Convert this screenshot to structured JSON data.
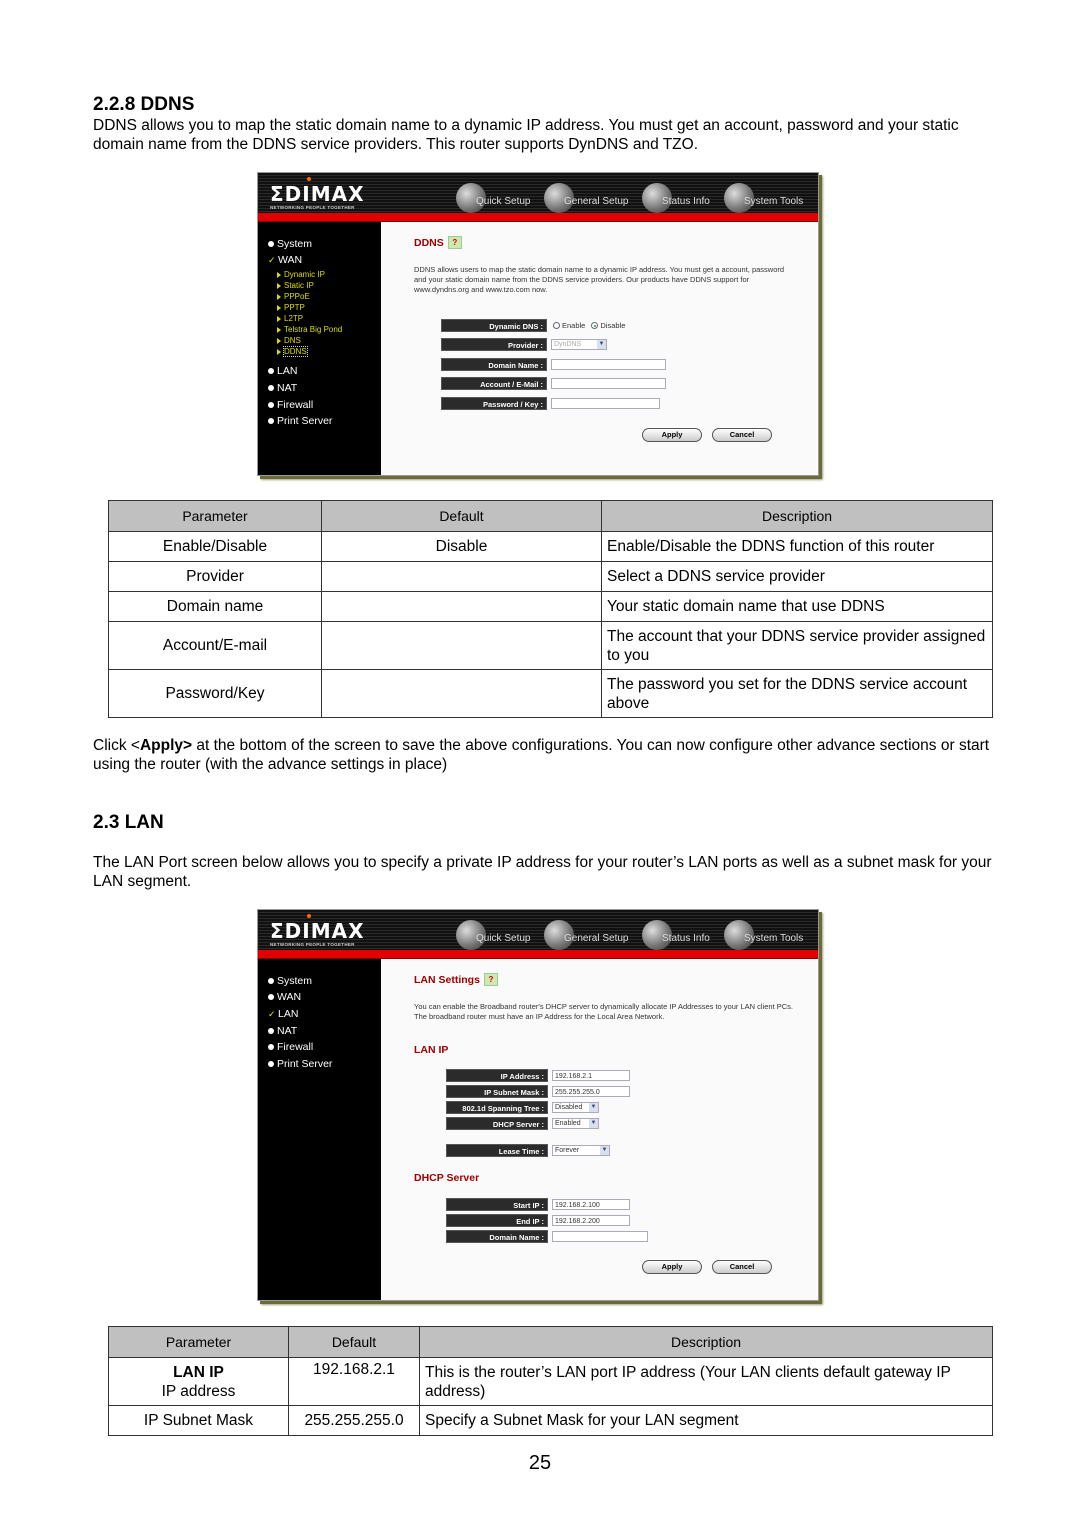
{
  "ddns_section": {
    "heading": "2.2.8 DDNS",
    "intro": "DDNS allows you to map the static domain name to a dynamic IP address. You must get an account, password and your static domain name from the DDNS service providers. This router supports DynDNS and TZO."
  },
  "router_ui": {
    "logo": "ΣDIMAX",
    "tagline": "NETWORKING PEOPLE TOGETHER",
    "nav": [
      "Quick Setup",
      "General Setup",
      "Status Info",
      "System Tools"
    ]
  },
  "ddns_screen": {
    "sidebar": {
      "top_items": [
        "System",
        "WAN"
      ],
      "wan_sub_items": [
        "Dynamic IP",
        "Static IP",
        "PPPoE",
        "PPTP",
        "L2TP",
        "Telstra Big Pond",
        "DNS",
        "DDNS"
      ],
      "bottom_items": [
        "LAN",
        "NAT",
        "Firewall",
        "Print Server"
      ]
    },
    "title": "DDNS",
    "description": "DDNS allows users to map the static domain name to a dynamic IP address. You must get a account, password and your static domain name from the DDNS service providers. Our products have DDNS support for www.dyndns.org and www.tzo.com now.",
    "fields": {
      "dynamic_dns_label": "Dynamic DNS :",
      "enable_label": "Enable",
      "disable_label": "Disable",
      "selected": "Disable",
      "provider_label": "Provider :",
      "provider_value": "DynDNS",
      "domain_name_label": "Domain Name :",
      "domain_name_value": "",
      "account_label": "Account / E-Mail :",
      "account_value": "",
      "password_label": "Password / Key :",
      "password_value": ""
    },
    "apply_label": "Apply",
    "cancel_label": "Cancel"
  },
  "ddns_table": {
    "headers": [
      "Parameter",
      "Default",
      "Description"
    ],
    "rows": [
      {
        "parameter": "Enable/Disable",
        "default": "Disable",
        "description": "Enable/Disable the DDNS function of this router"
      },
      {
        "parameter": "Provider",
        "default": "",
        "description": "Select a DDNS service provider"
      },
      {
        "parameter": "Domain name",
        "default": "",
        "description": "Your static domain name that use DDNS"
      },
      {
        "parameter": "Account/E-mail",
        "default": "",
        "description": "The account that your DDNS service provider assigned to you"
      },
      {
        "parameter": "Password/Key",
        "default": "",
        "description": "The password you set for the DDNS service account above"
      }
    ]
  },
  "apply_note": {
    "prefix": "Click <",
    "bold": "Apply>",
    "suffix": " at the bottom of the screen to save the above configurations. You can now configure other advance sections or start using the router (with the advance settings in place)"
  },
  "lan_section": {
    "heading": "2.3 LAN",
    "intro": "The LAN Port screen below allows you to specify a private IP address for your router’s LAN ports as well as a subnet mask for your LAN segment."
  },
  "lan_screen": {
    "sidebar": {
      "items": [
        "System",
        "WAN",
        "LAN",
        "NAT",
        "Firewall",
        "Print Server"
      ],
      "active": "LAN"
    },
    "title": "LAN Settings",
    "description": "You can enable the Broadband router's DHCP server to dynamically allocate IP Addresses to your LAN client PCs. The broadband router must have an IP Address for the Local Area Network.",
    "lan_ip_heading": "LAN IP",
    "fields": {
      "ip_address_label": "IP Address :",
      "ip_address_value": "192.168.2.1",
      "subnet_label": "IP Subnet Mask :",
      "subnet_value": "255.255.255.0",
      "spanning_label": "802.1d Spanning Tree :",
      "spanning_value": "Disabled",
      "dhcp_label": "DHCP Server :",
      "dhcp_value": "Enabled",
      "lease_label": "Lease Time :",
      "lease_value": "Forever"
    },
    "dhcp_heading": "DHCP Server",
    "dhcp_fields": {
      "start_label": "Start IP :",
      "start_value": "192.168.2.100",
      "end_label": "End IP :",
      "end_value": "192.168.2.200",
      "domain_label": "Domain Name :",
      "domain_value": ""
    },
    "apply_label": "Apply",
    "cancel_label": "Cancel"
  },
  "lan_table": {
    "headers": [
      "Parameter",
      "Default",
      "Description"
    ],
    "rows": [
      {
        "parameter_bold": "LAN IP",
        "parameter": "IP address",
        "default": "192.168.2.1",
        "description": "This is the router’s LAN port IP address (Your LAN clients default gateway IP address)"
      },
      {
        "parameter_bold": "",
        "parameter": "IP Subnet Mask",
        "default": "255.255.255.0",
        "description": "Specify a Subnet Mask for your LAN segment"
      }
    ]
  },
  "page_number": "25"
}
